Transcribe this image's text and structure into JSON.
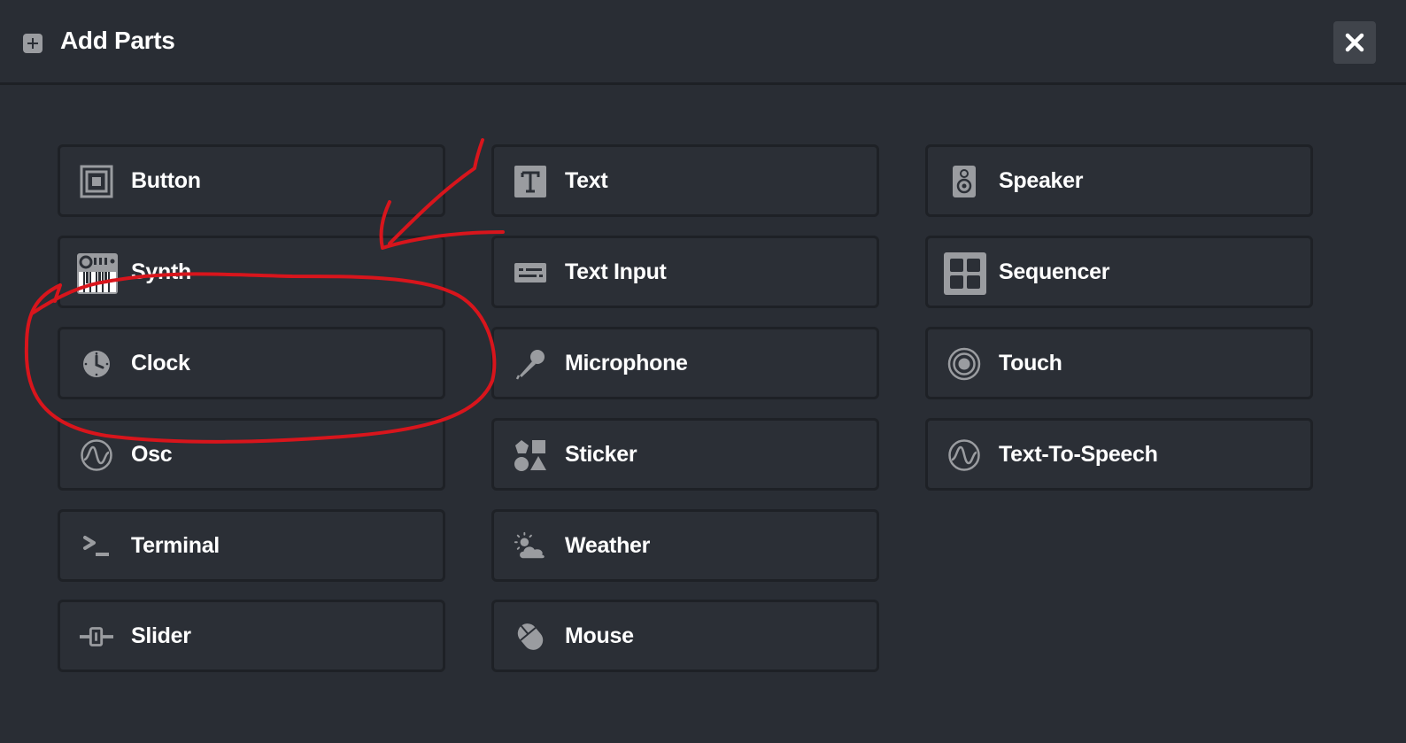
{
  "header": {
    "title": "Add Parts",
    "icon": "plus-square-icon",
    "close_icon": "close-icon"
  },
  "colors": {
    "background": "#292d34",
    "card_background": "#2b2f36",
    "card_border": "#1e2126",
    "icon": "#9a9ca0",
    "text": "#ffffff",
    "annotation": "#d8151c"
  },
  "parts": [
    {
      "label": "Button",
      "icon": "button-icon"
    },
    {
      "label": "Synth",
      "icon": "synth-icon"
    },
    {
      "label": "Clock",
      "icon": "clock-icon"
    },
    {
      "label": "Osc",
      "icon": "oscillator-icon"
    },
    {
      "label": "Terminal",
      "icon": "terminal-icon"
    },
    {
      "label": "Slider",
      "icon": "slider-icon"
    },
    {
      "label": "Text",
      "icon": "text-icon"
    },
    {
      "label": "Text Input",
      "icon": "keyboard-icon"
    },
    {
      "label": "Microphone",
      "icon": "microphone-icon"
    },
    {
      "label": "Sticker",
      "icon": "shapes-icon"
    },
    {
      "label": "Weather",
      "icon": "weather-icon"
    },
    {
      "label": "Mouse",
      "icon": "mouse-icon"
    },
    {
      "label": "Speaker",
      "icon": "speaker-icon"
    },
    {
      "label": "Sequencer",
      "icon": "grid-icon"
    },
    {
      "label": "Touch",
      "icon": "touch-icon"
    },
    {
      "label": "Text-To-Speech",
      "icon": "wave-circle-icon"
    }
  ],
  "annotation": {
    "highlighted_part": "Clock",
    "marks": [
      "red-arrow",
      "red-circle"
    ]
  }
}
